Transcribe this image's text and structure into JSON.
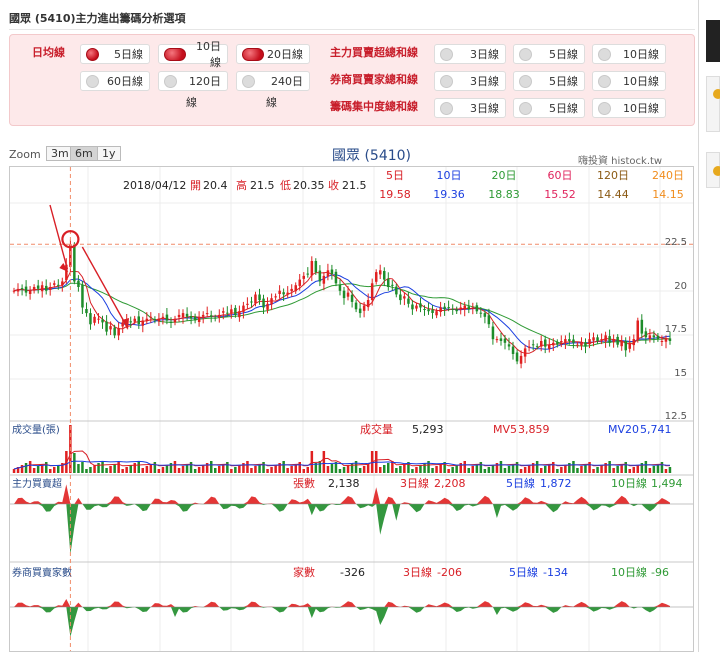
{
  "title": "國眾 (5410)主力進出籌碼分析選項",
  "options": {
    "ma_label": "日均線",
    "ma": [
      {
        "label": "5日線",
        "on": true
      },
      {
        "label": "10日線",
        "on": true
      },
      {
        "label": "20日線",
        "on": true
      },
      {
        "label": "60日線",
        "on": false
      },
      {
        "label": "120日",
        "wrap": "線",
        "on": false
      },
      {
        "label": "240日",
        "wrap": "線",
        "on": false
      }
    ],
    "rows": [
      {
        "label": "主力買賣超總和線",
        "items": [
          "3日線",
          "5日線",
          "10日線"
        ]
      },
      {
        "label": "券商買賣家總和線",
        "items": [
          "3日線",
          "5日線",
          "10日線"
        ]
      },
      {
        "label": "籌碼集中度總和線",
        "items": [
          "3日線",
          "5日線",
          "10日線"
        ]
      }
    ]
  },
  "zoom": {
    "label": "Zoom",
    "buttons": [
      "3m",
      "6m",
      "1y"
    ],
    "active": "6m"
  },
  "chart_title": "國眾 (5410)",
  "brand": "嗨投資 histock.tw",
  "colors": {
    "up": "#e02020",
    "down": "#1e8c2a",
    "ma5": "#d81f26",
    "ma10": "#1a3ee0",
    "ma20": "#2f9a35",
    "ma60": "#e0245d",
    "ma120": "#8b5a14",
    "ma240": "#f08c1c"
  },
  "chart_data": [
    {
      "type": "candlestick",
      "info": {
        "date": "2018/04/12",
        "open_label": "開",
        "open": "20.4",
        "high_label": "高",
        "high": "21.5",
        "low_label": "低",
        "low": "20.35",
        "close_label": "收",
        "close": "21.5"
      },
      "ma_headers": [
        "5日",
        "10日",
        "20日",
        "60日",
        "120日",
        "240日"
      ],
      "ma_values": [
        "19.58",
        "19.36",
        "18.83",
        "15.52",
        "14.44",
        "14.15"
      ],
      "ylim": [
        12,
        23.5
      ],
      "yticks": [
        "22.5",
        "20",
        "17.5",
        "15",
        "12.5"
      ],
      "price_line": 21.5,
      "selected_index": 14,
      "close": [
        19.0,
        19.1,
        19.1,
        18.9,
        19.0,
        19.2,
        19.1,
        19.3,
        19.0,
        19.2,
        19.4,
        19.3,
        19.5,
        20.4,
        21.5,
        19.5,
        19.2,
        18.1,
        17.8,
        17.2,
        17.6,
        17.5,
        17.3,
        16.8,
        17.1,
        16.6,
        17.0,
        17.3,
        17.4,
        17.3,
        17.5,
        17.2,
        17.4,
        17.5,
        17.6,
        17.4,
        17.5,
        17.6,
        17.4,
        17.3,
        17.5,
        17.7,
        17.8,
        17.6,
        17.5,
        17.4,
        17.6,
        17.7,
        17.8,
        17.6,
        17.5,
        17.7,
        17.9,
        17.8,
        18.0,
        17.7,
        17.9,
        18.2,
        18.3,
        18.4,
        18.8,
        18.5,
        18.1,
        18.3,
        18.6,
        18.7,
        19.0,
        18.8,
        18.9,
        19.1,
        19.3,
        19.6,
        19.8,
        19.9,
        20.6,
        20.0,
        19.5,
        19.8,
        20.1,
        19.9,
        19.4,
        19.0,
        18.6,
        18.9,
        18.4,
        18.0,
        17.8,
        18.2,
        18.5,
        19.4,
        20.0,
        20.1,
        19.6,
        19.2,
        19.3,
        18.8,
        18.5,
        18.7,
        18.3,
        18.0,
        18.2,
        18.1,
        18.0,
        17.9,
        17.8,
        17.9,
        18.1,
        18.0,
        18.1,
        18.0,
        17.9,
        18.1,
        18.2,
        18.0,
        18.1,
        17.9,
        17.8,
        17.6,
        17.2,
        16.4,
        16.4,
        16.3,
        16.2,
        16.0,
        15.6,
        15.2,
        15.5,
        15.9,
        16.0,
        16.1,
        16.0,
        16.3,
        16.0,
        16.1,
        16.2,
        16.1,
        16.3,
        16.4,
        16.3,
        16.2,
        16.1,
        16.2,
        16.0,
        16.4,
        16.5,
        16.3,
        16.4,
        16.6,
        16.2,
        16.4,
        16.1,
        16.3,
        15.8,
        16.2,
        16.4,
        17.4,
        16.7,
        16.5,
        16.6,
        16.5,
        16.4,
        16.3,
        16.4,
        16.3
      ]
    },
    {
      "type": "bar",
      "title": "成交量(張)",
      "stats": [
        {
          "label": "成交量",
          "value": "5,293"
        },
        {
          "label": "MV5",
          "value": "3,859"
        },
        {
          "label": "MV20",
          "value": "5,741"
        }
      ]
    },
    {
      "type": "area",
      "title": "主力買賣超",
      "stats": [
        {
          "label": "張數",
          "value": "2,138"
        },
        {
          "label": "3日線",
          "value": "2,208"
        },
        {
          "label": "5日線",
          "value": "1,872"
        },
        {
          "label": "10日線",
          "value": "1,494"
        }
      ]
    },
    {
      "type": "area",
      "title": "券商買賣家數",
      "stats": [
        {
          "label": "家數",
          "value": "-326"
        },
        {
          "label": "3日線",
          "value": "-206"
        },
        {
          "label": "5日線",
          "value": "-134"
        },
        {
          "label": "10日線",
          "value": "-96"
        }
      ]
    }
  ]
}
